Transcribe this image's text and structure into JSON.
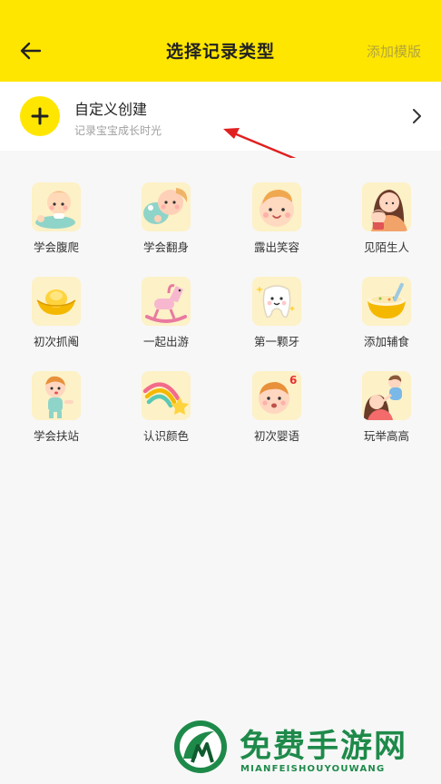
{
  "header": {
    "title": "选择记录类型",
    "back_icon": "arrow-left-icon",
    "add_template_label": "添加模版",
    "bg_color": "#ffe600"
  },
  "custom": {
    "title": "自定义创建",
    "subtitle": "记录宝宝成长时光",
    "icon": "plus-icon",
    "chevron_icon": "chevron-right-icon"
  },
  "records": [
    {
      "label": "学会腹爬",
      "icon": "crawling-baby-icon"
    },
    {
      "label": "学会翻身",
      "icon": "rolling-baby-icon"
    },
    {
      "label": "露出笑容",
      "icon": "smiling-baby-icon"
    },
    {
      "label": "见陌生人",
      "icon": "mother-baby-icon"
    },
    {
      "label": "初次抓阄",
      "icon": "gold-ingot-icon"
    },
    {
      "label": "一起出游",
      "icon": "rocking-horse-icon"
    },
    {
      "label": "第一颗牙",
      "icon": "tooth-icon"
    },
    {
      "label": "添加辅食",
      "icon": "food-bowl-icon"
    },
    {
      "label": "学会扶站",
      "icon": "standing-baby-icon"
    },
    {
      "label": "认识颜色",
      "icon": "rainbow-star-icon"
    },
    {
      "label": "初次婴语",
      "icon": "talking-baby-icon"
    },
    {
      "label": "玩举高高",
      "icon": "lifting-baby-icon"
    }
  ],
  "watermark": {
    "title": "免费手游网",
    "subtitle": "MIANFEISHOUYOUWANG"
  }
}
